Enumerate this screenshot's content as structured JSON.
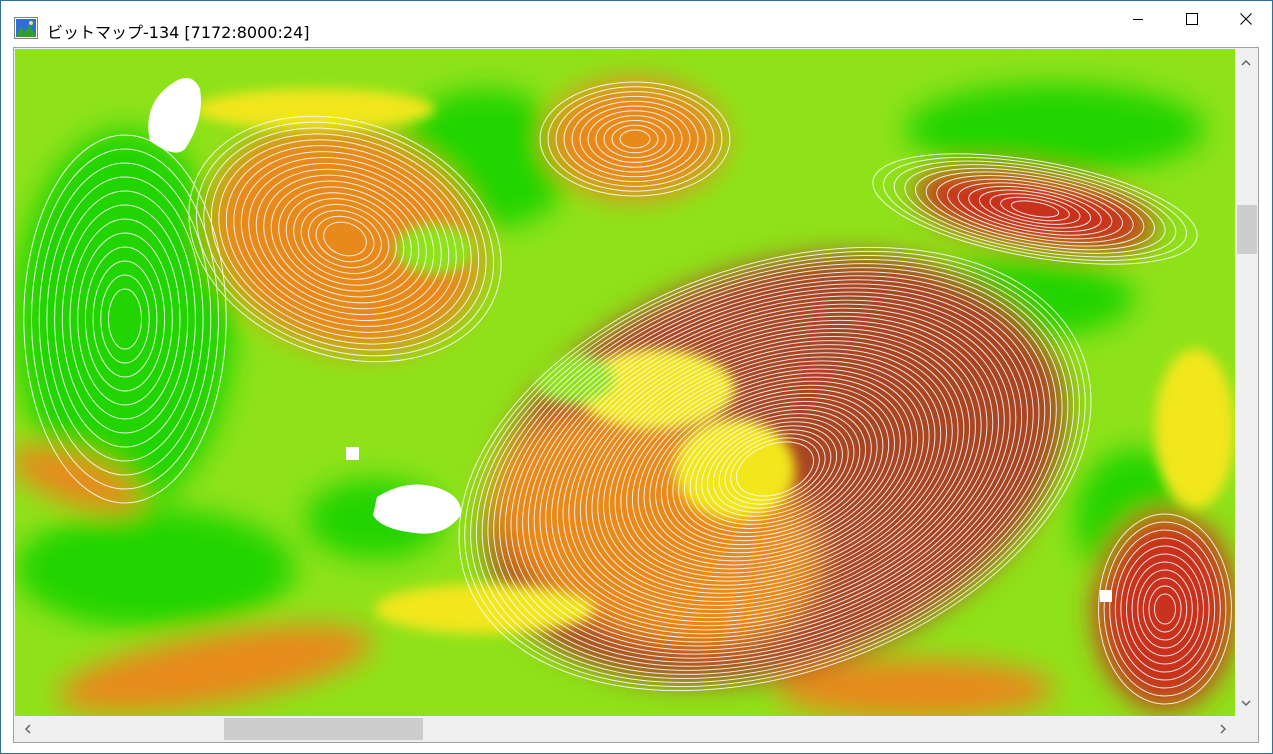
{
  "window": {
    "title": "ビットマップ-134 [7172:8000:24]",
    "icon": "bitmap-app-icon",
    "controls": {
      "minimize_icon": "minimize-icon",
      "maximize_icon": "maximize-icon",
      "close_icon": "close-icon"
    }
  },
  "map": {
    "description_icon": "slope-raster-image",
    "palette": {
      "flat": "#22d400",
      "gentle": "#8fe21a",
      "moderate": "#f2e61a",
      "steep": "#e8891e",
      "very_steep": "#c8331a",
      "extreme": "#a84424",
      "contour": "#ffffff",
      "nodata": "#ffffff"
    }
  },
  "scrollbars": {
    "vertical": {
      "position": 0.23,
      "visible_fraction": 0.08
    },
    "horizontal": {
      "position": 0.19,
      "visible_fraction": 0.17
    }
  }
}
